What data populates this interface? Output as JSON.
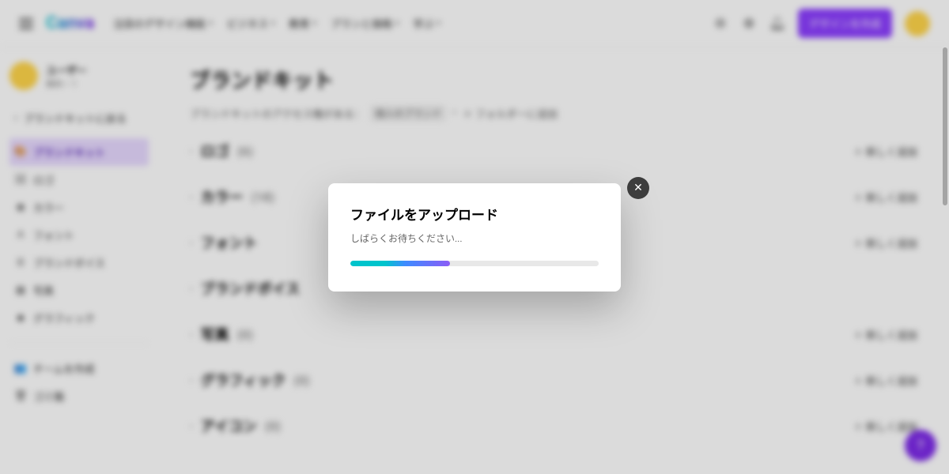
{
  "topbar": {
    "logo": "Canva",
    "nav": [
      {
        "label": "注目のデザイン機能"
      },
      {
        "label": "ビジネス"
      },
      {
        "label": "教育"
      },
      {
        "label": "プランと価格"
      },
      {
        "label": "学ぶ"
      }
    ],
    "cta": "デザインを作成"
  },
  "sidebar": {
    "user_name": "ユーザー",
    "user_sub": "無料・1",
    "back": "ブランドキットに戻る",
    "items": [
      {
        "label": "ブランドキット",
        "selected": true,
        "icon": "palette"
      },
      {
        "label": "ロゴ",
        "icon": "image"
      },
      {
        "label": "カラー",
        "icon": "droplet"
      },
      {
        "label": "フォント",
        "icon": "font"
      },
      {
        "label": "ブランドボイス",
        "icon": "voice"
      },
      {
        "label": "写真",
        "icon": "photo"
      },
      {
        "label": "グラフィック",
        "icon": "graphic"
      }
    ],
    "footer": [
      {
        "label": "チームを作成"
      },
      {
        "label": "ゴミ箱"
      }
    ]
  },
  "main": {
    "title": "ブランドキット",
    "crumb_prefix": "ブランドキットのアクセス権がある：",
    "crumb_chip": "個人のブランド",
    "crumb_tail": "＋ フォルダーに追加",
    "rows": [
      {
        "title": "ロゴ",
        "count": "(6)",
        "add": "新しく追加",
        "has_add": true
      },
      {
        "title": "カラー",
        "count": "(18)",
        "add": "新しく追加",
        "has_add": true
      },
      {
        "title": "フォント",
        "count": "",
        "add": "新しく追加",
        "has_add": true
      },
      {
        "title": "ブランドボイス",
        "count": "",
        "add": "",
        "has_add": false
      },
      {
        "title": "写真",
        "count": "(0)",
        "add": "新しく追加",
        "has_add": true
      },
      {
        "title": "グラフィック",
        "count": "(0)",
        "add": "新しく追加",
        "has_add": true
      },
      {
        "title": "アイコン",
        "count": "(0)",
        "add": "新しく追加",
        "has_add": true
      }
    ]
  },
  "modal": {
    "title": "ファイルをアップロード",
    "subtitle": "しばらくお待ちください...",
    "progress_percent": 40
  }
}
